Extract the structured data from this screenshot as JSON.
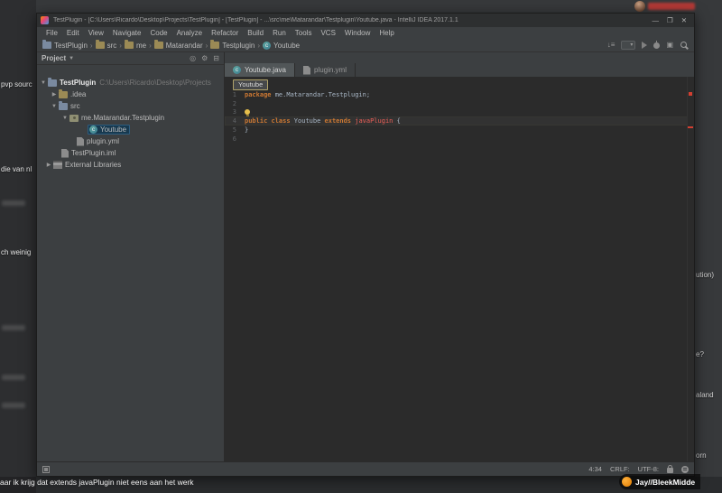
{
  "overlay": {
    "chat_left": [
      {
        "text": "pvp sourc"
      },
      {
        "text": "die van nl"
      },
      {
        "text": "ch weinig"
      }
    ],
    "right_fragments": [
      {
        "text": "ution)"
      },
      {
        "text": "e?"
      },
      {
        "text": "aland"
      },
      {
        "text": "orn"
      }
    ],
    "bottom_message": "aar ik krijg dat extends javaPlugin niet eens aan het werk",
    "watermark": "Jay//BleekMidde"
  },
  "window": {
    "title": "TestPlugin - [C:\\Users\\Ricardo\\Desktop\\Projects\\TestPlugin] - [TestPlugin] - ...\\src\\me\\Matarandar\\Testplugin\\Youtube.java - IntelliJ IDEA 2017.1.1",
    "controls": {
      "minimize": "—",
      "maximize": "❐",
      "close": "✕"
    }
  },
  "menu": {
    "items": [
      "File",
      "Edit",
      "View",
      "Navigate",
      "Code",
      "Analyze",
      "Refactor",
      "Build",
      "Run",
      "Tools",
      "VCS",
      "Window",
      "Help"
    ]
  },
  "breadcrumbs": [
    "TestPlugin",
    "src",
    "me",
    "Matarandar",
    "Testplugin",
    "Youtube"
  ],
  "project_panel": {
    "title": "Project"
  },
  "tabs": [
    {
      "label": "Youtube.java"
    },
    {
      "label": "plugin.yml"
    }
  ],
  "tree": {
    "rows": [
      {
        "label": "TestPlugin",
        "extra": "C:\\Users\\Ricardo\\Desktop\\Projects"
      },
      {
        "label": ".idea"
      },
      {
        "label": "src"
      },
      {
        "label": "me.Matarandar.Testplugin"
      },
      {
        "label": "Youtube"
      },
      {
        "label": "plugin.yml"
      },
      {
        "label": "TestPlugin.iml"
      },
      {
        "label": "External Libraries"
      }
    ]
  },
  "editor": {
    "hint": "Youtube",
    "gutter": [
      "1",
      "2",
      "3",
      "4",
      "5",
      "6"
    ],
    "code": {
      "l1_kw": "package ",
      "l1_rest": "me.Matarandar.Testplugin;",
      "l4_kw1": "public class ",
      "l4_name": "Youtube ",
      "l4_kw2": "extends ",
      "l4_err": "javaPlugin ",
      "l4_brace": "{",
      "l5": "}"
    }
  },
  "status_bar": {
    "position": "4:34",
    "line_ending": "CRLF:",
    "encoding": "UTF-8:"
  },
  "colors": {
    "keyword": "#cc7832",
    "error_text": "#f06058",
    "editor_bg": "#2b2b2b",
    "panel_bg": "#3c3f41",
    "error_stripe": "#d23f31"
  }
}
